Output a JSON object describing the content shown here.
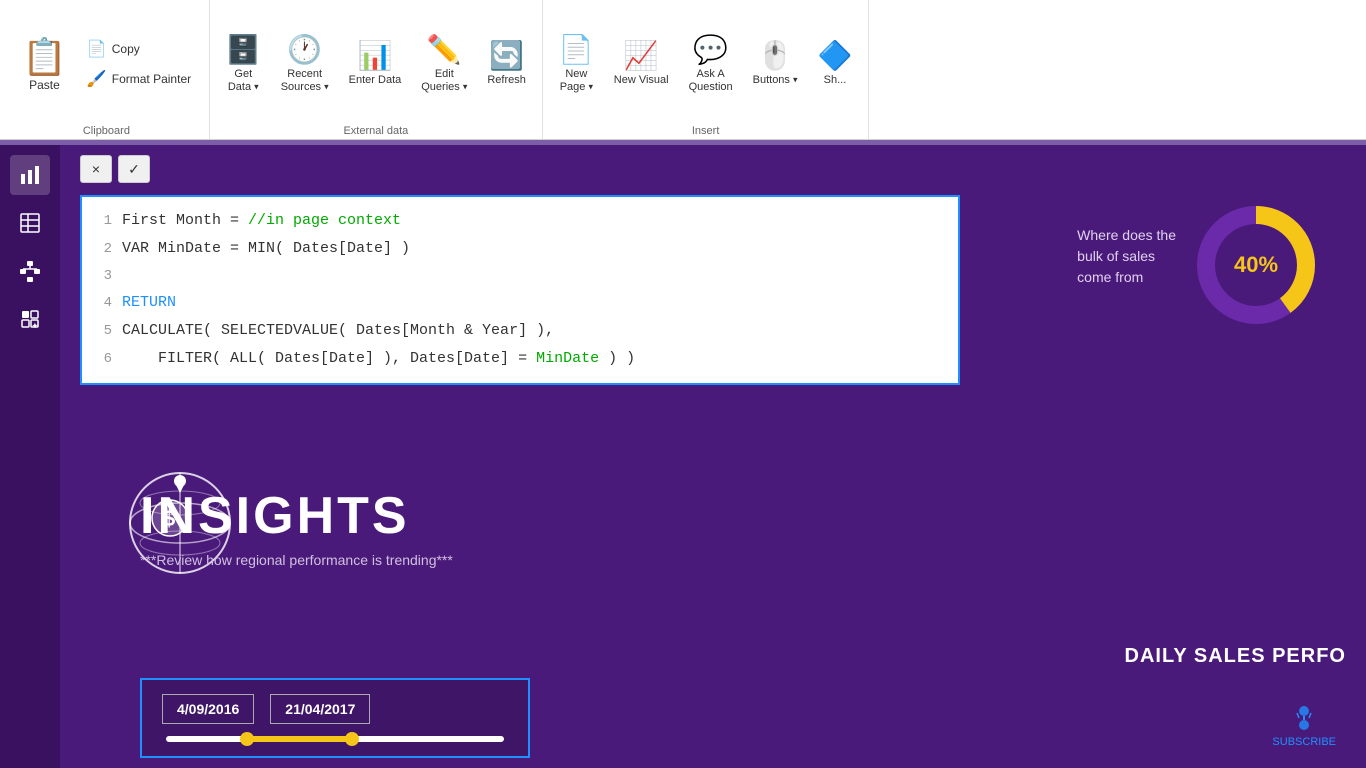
{
  "ribbon": {
    "clipboard": {
      "label": "Clipboard",
      "paste_label": "Paste",
      "copy_label": "Copy",
      "format_painter_label": "Format Painter"
    },
    "external_data": {
      "label": "External data",
      "get_data_label": "Get\nData",
      "recent_sources_label": "Recent\nSources",
      "enter_data_label": "Enter\nData",
      "edit_queries_label": "Edit\nQueries",
      "refresh_label": "Refresh"
    },
    "insert": {
      "label": "Insert",
      "new_page_label": "New\nPage",
      "new_visual_label": "New\nVisual",
      "ask_question_label": "Ask A\nQuestion",
      "buttons_label": "Buttons"
    }
  },
  "sidebar": {
    "icons": [
      "bar-chart-icon",
      "table-icon",
      "hierarchy-icon",
      "ai-icon"
    ]
  },
  "code_editor": {
    "toolbar": {
      "close_label": "×",
      "check_label": "✓"
    },
    "lines": [
      {
        "num": "1",
        "parts": [
          {
            "text": "First Month = ",
            "style": "normal"
          },
          {
            "text": "//in page context",
            "style": "green"
          }
        ]
      },
      {
        "num": "2",
        "parts": [
          {
            "text": "VAR MinDate = MIN( Dates[Date] )",
            "style": "normal"
          }
        ]
      },
      {
        "num": "3",
        "parts": []
      },
      {
        "num": "4",
        "parts": [
          {
            "text": "RETURN",
            "style": "blue"
          }
        ]
      },
      {
        "num": "5",
        "parts": [
          {
            "text": "CALCULATE( SELECTEDVALUE( Dates[Month & Year] ),",
            "style": "normal"
          }
        ]
      },
      {
        "num": "6",
        "parts": [
          {
            "text": "    FILTER( ALL( Dates[Date] ), Dates[Date] = ",
            "style": "normal"
          },
          {
            "text": "MinDate",
            "style": "green"
          },
          {
            "text": " ) )",
            "style": "normal"
          }
        ]
      }
    ]
  },
  "dashboard": {
    "insights_title": "INSIGHTS",
    "insights_sub": "***Review how regional performance is trending***",
    "bulk_text_line1": "Where does the",
    "bulk_text_line2": "bulk of sales",
    "bulk_text_line3": "come from",
    "donut_percent": "40%",
    "date_start": "4/09/2016",
    "date_end": "21/04/2017",
    "daily_sales": "DAILY SALES PERFO",
    "subscribe_label": "SUBSCRIBE"
  }
}
